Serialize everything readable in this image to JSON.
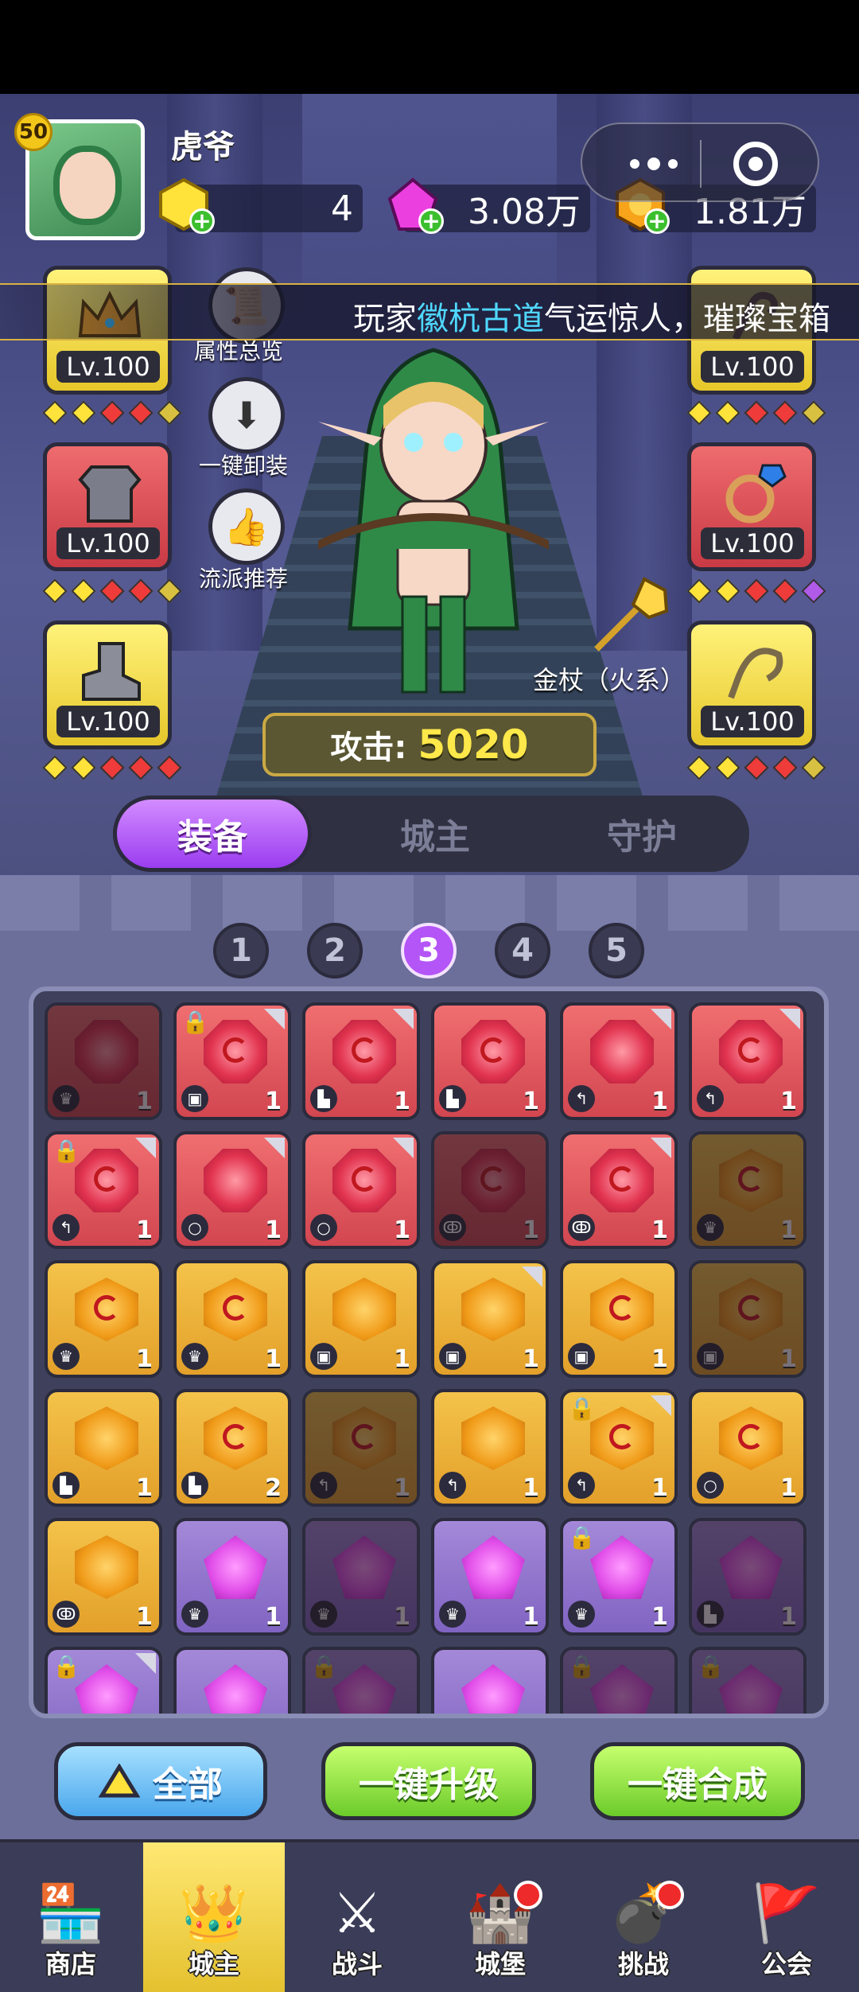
{
  "player": {
    "level": "50",
    "name": "虎爷"
  },
  "resources": {
    "yellow_gem": "4",
    "pink_gem": "3.08万",
    "coin": "1.81万"
  },
  "ticker": {
    "prefix": "玩家",
    "highlight": "徽杭古道",
    "suffix": "气运惊人，璀璨宝箱"
  },
  "equip_slots": {
    "left": [
      {
        "icon": "crown-icon",
        "level": "Lv.100"
      },
      {
        "icon": "armor-icon",
        "level": "Lv.100"
      },
      {
        "icon": "boot-icon",
        "level": "Lv.100"
      }
    ],
    "right": [
      {
        "icon": "hook-icon",
        "level": "Lv.100"
      },
      {
        "icon": "ring-icon",
        "level": "Lv.100"
      },
      {
        "icon": "whip-icon",
        "level": "Lv.100"
      }
    ]
  },
  "actions": {
    "overview": "属性总览",
    "unequip_all": "一键卸装",
    "recommend": "流派推荐"
  },
  "weapon_label": "金杖（火系）",
  "attack": {
    "label": "攻击:",
    "value": "5020"
  },
  "tabs": [
    {
      "label": "装备"
    },
    {
      "label": "城主"
    },
    {
      "label": "守护"
    }
  ],
  "pages": [
    "1",
    "2",
    "3",
    "4",
    "5"
  ],
  "buttons": {
    "all": "全部",
    "upgrade_all": "一键升级",
    "merge_all": "一键合成"
  },
  "nav": [
    {
      "label": "商店",
      "icon": "shop-icon"
    },
    {
      "label": "城主",
      "icon": "crown-icon"
    },
    {
      "label": "战斗",
      "icon": "swords-icon"
    },
    {
      "label": "城堡",
      "icon": "castle-icon"
    },
    {
      "label": "挑战",
      "icon": "skull-icon"
    },
    {
      "label": "公会",
      "icon": "banner-icon"
    }
  ]
}
